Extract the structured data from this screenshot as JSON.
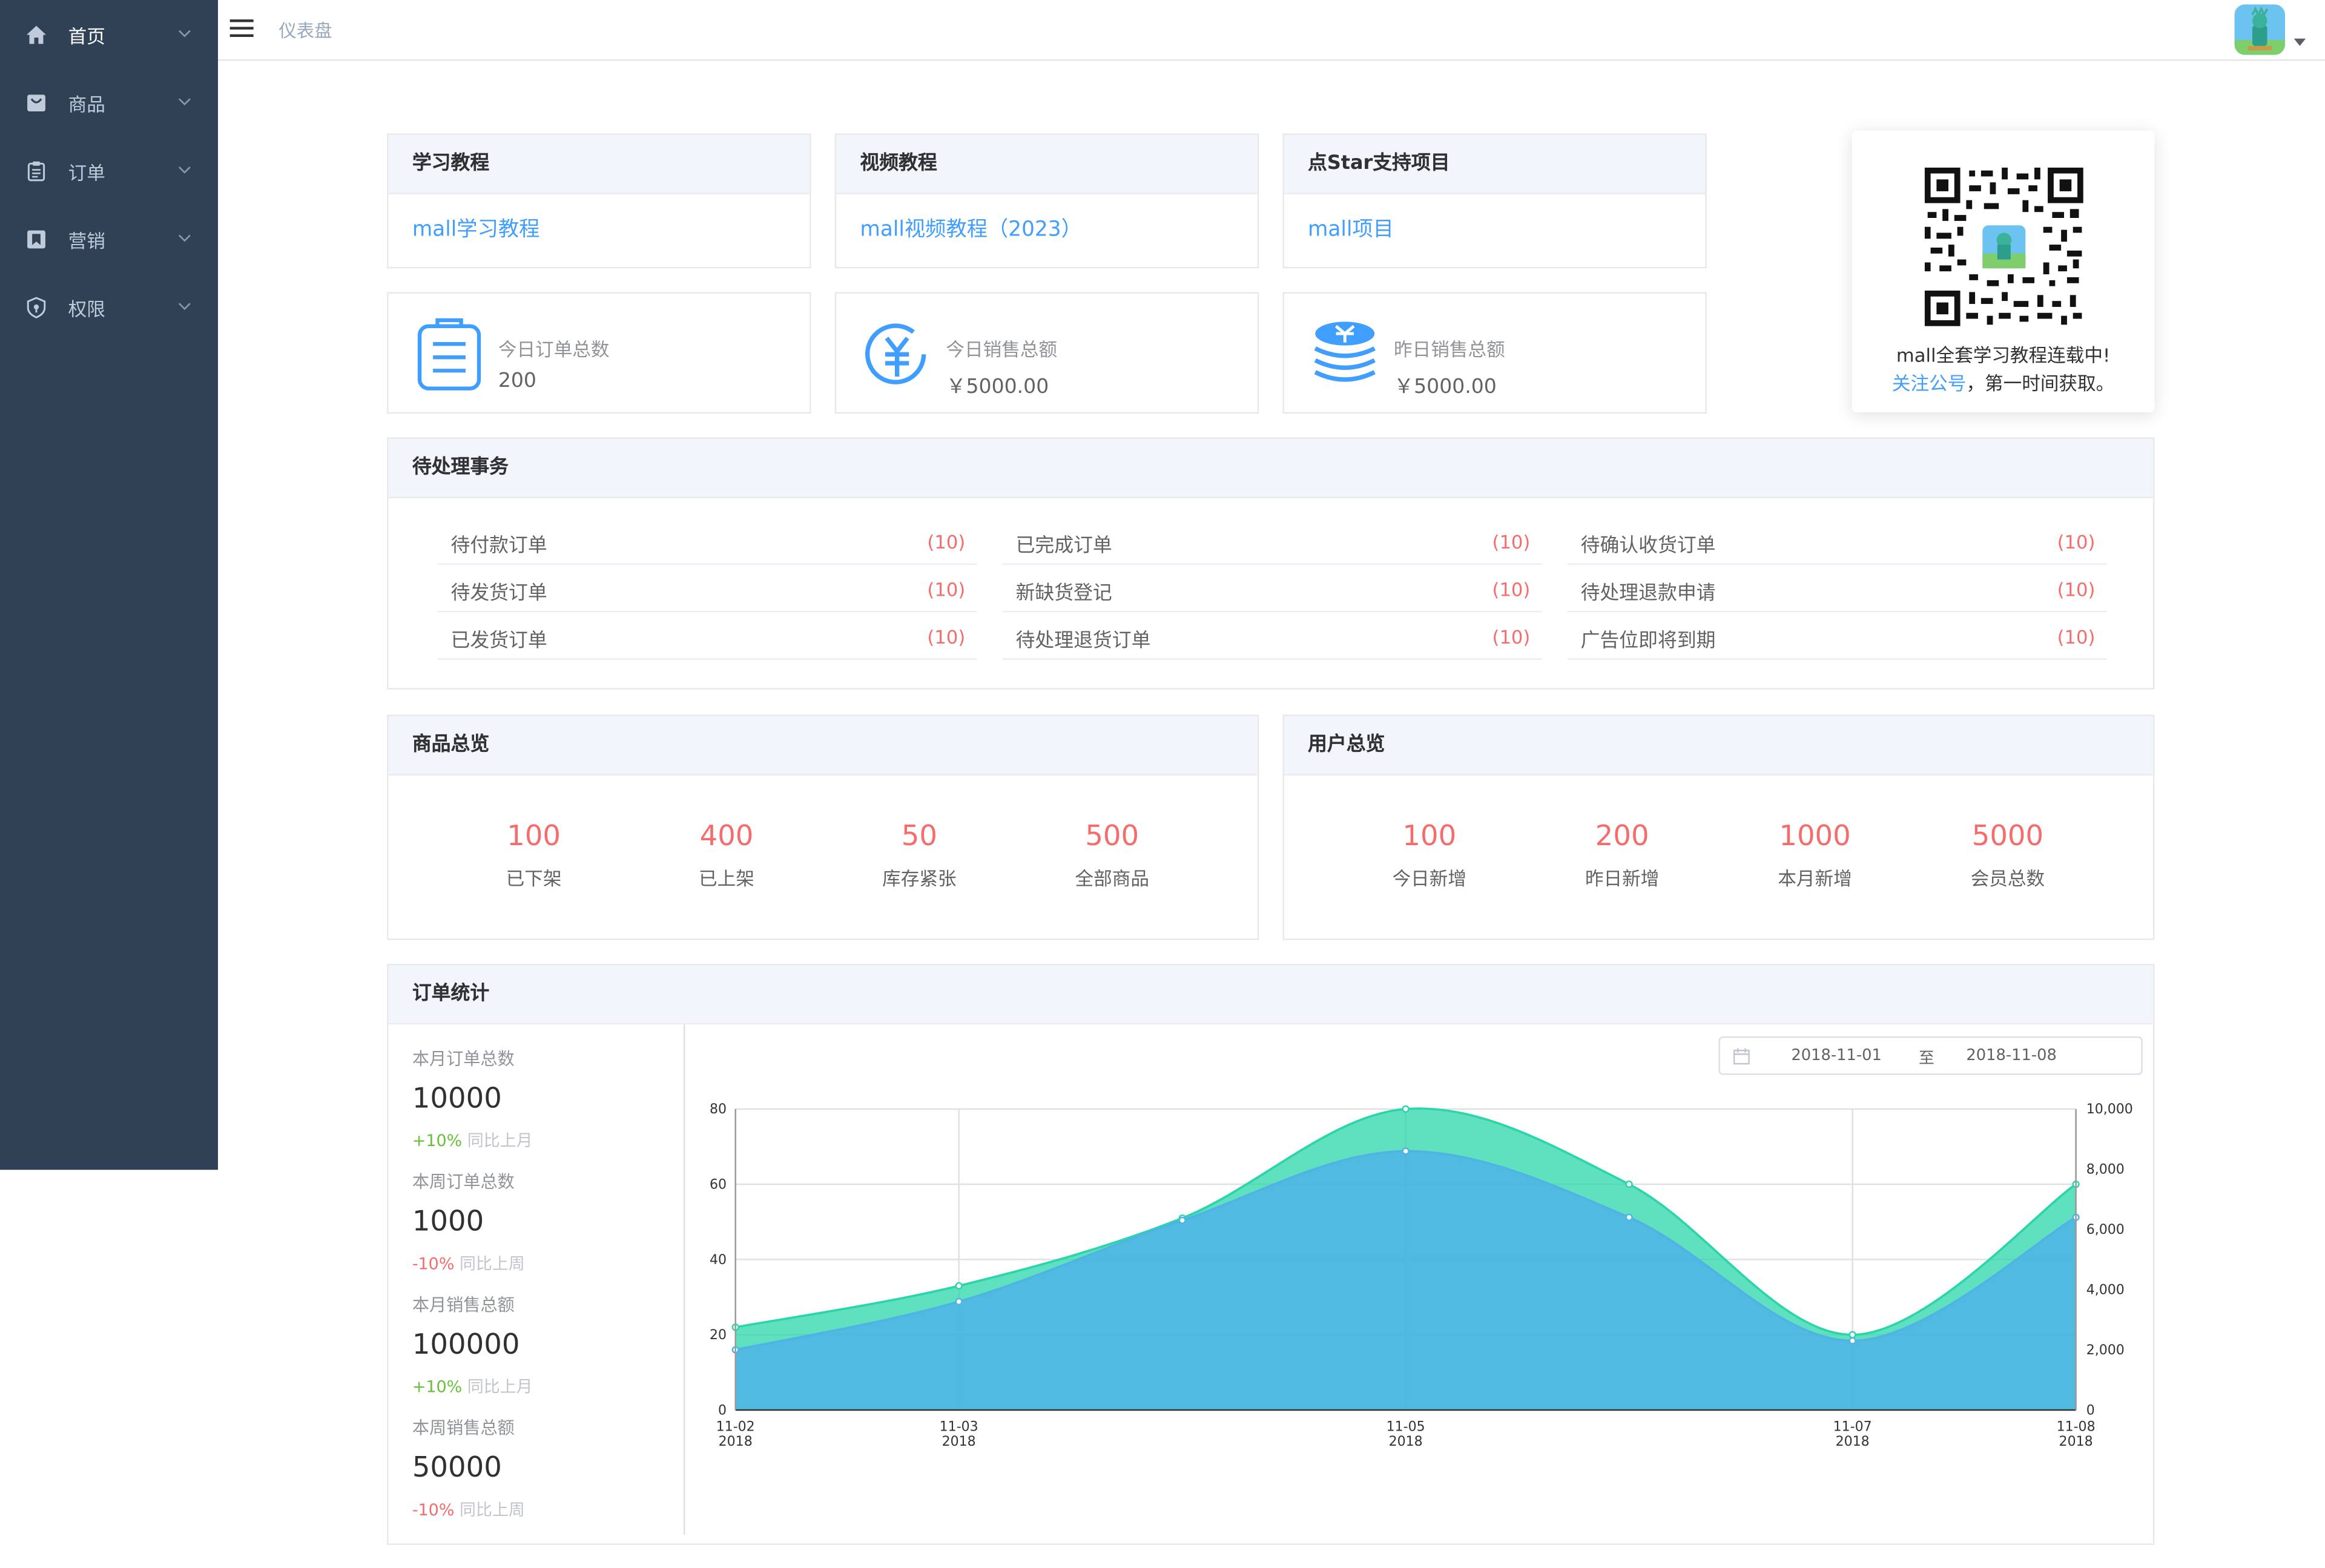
{
  "sidebar": {
    "items": [
      {
        "label": "首页",
        "icon": "home-icon"
      },
      {
        "label": "商品",
        "icon": "product-icon"
      },
      {
        "label": "订单",
        "icon": "order-icon"
      },
      {
        "label": "营销",
        "icon": "marketing-icon"
      },
      {
        "label": "权限",
        "icon": "permission-icon"
      }
    ]
  },
  "header": {
    "breadcrumb": "仪表盘",
    "menu_icon": "hamburger-icon",
    "avatar_icon": "avatar-icon"
  },
  "tutorials": [
    {
      "title": "学习教程",
      "link": "mall学习教程"
    },
    {
      "title": "视频教程",
      "link": "mall视频教程（2023）"
    },
    {
      "title": "点Star支持项目",
      "link": "mall项目"
    }
  ],
  "stats": [
    {
      "title": "今日订单总数",
      "value": "200",
      "icon": "clipboard-icon"
    },
    {
      "title": "今日销售总额",
      "value": "￥5000.00",
      "icon": "yuan-icon"
    },
    {
      "title": "昨日销售总额",
      "value": "￥5000.00",
      "icon": "coins-icon"
    }
  ],
  "qrcode": {
    "line1": "mall全套学习教程连载中!",
    "link": "关注公号",
    "line2_rest": "，第一时间获取。"
  },
  "todo": {
    "title": "待处理事务",
    "columns": [
      [
        {
          "label": "待付款订单",
          "count": "(10)"
        },
        {
          "label": "待发货订单",
          "count": "(10)"
        },
        {
          "label": "已发货订单",
          "count": "(10)"
        }
      ],
      [
        {
          "label": "已完成订单",
          "count": "(10)"
        },
        {
          "label": "新缺货登记",
          "count": "(10)"
        },
        {
          "label": "待处理退货订单",
          "count": "(10)"
        }
      ],
      [
        {
          "label": "待确认收货订单",
          "count": "(10)"
        },
        {
          "label": "待处理退款申请",
          "count": "(10)"
        },
        {
          "label": "广告位即将到期",
          "count": "(10)"
        }
      ]
    ]
  },
  "product_overview": {
    "title": "商品总览",
    "items": [
      {
        "value": "100",
        "label": "已下架"
      },
      {
        "value": "400",
        "label": "已上架"
      },
      {
        "value": "50",
        "label": "库存紧张"
      },
      {
        "value": "500",
        "label": "全部商品"
      }
    ]
  },
  "user_overview": {
    "title": "用户总览",
    "items": [
      {
        "value": "100",
        "label": "今日新增"
      },
      {
        "value": "200",
        "label": "昨日新增"
      },
      {
        "value": "1000",
        "label": "本月新增"
      },
      {
        "value": "5000",
        "label": "会员总数"
      }
    ]
  },
  "order_stats": {
    "title": "订单统计",
    "blocks": [
      {
        "title": "本月订单总数",
        "value": "10000",
        "change": "+10%",
        "compare": "同比上月",
        "trend": "up"
      },
      {
        "title": "本周订单总数",
        "value": "1000",
        "change": "-10%",
        "compare": "同比上周",
        "trend": "down"
      },
      {
        "title": "本月销售总额",
        "value": "100000",
        "change": "+10%",
        "compare": "同比上月",
        "trend": "up"
      },
      {
        "title": "本周销售总额",
        "value": "50000",
        "change": "-10%",
        "compare": "同比上周",
        "trend": "down"
      }
    ],
    "date_range": {
      "start": "2018-11-01",
      "separator": "至",
      "end": "2018-11-08",
      "icon": "calendar-icon"
    }
  },
  "colors": {
    "sidebar_bg": "#304156",
    "link": "#409eff",
    "danger": "#f56c6c",
    "success": "#67c23a",
    "series_orders": "#2ad6a9",
    "series_sales": "#4fb3e6"
  },
  "chart_data": {
    "type": "area",
    "x": [
      "2018-11-02",
      "2018-11-03",
      "2018-11-04",
      "2018-11-05",
      "2018-11-06",
      "2018-11-07",
      "2018-11-08"
    ],
    "x_tick_labels": [
      {
        "date": "11-02",
        "year": "2018"
      },
      {
        "date": "11-03",
        "year": "2018"
      },
      {
        "date": "11-05",
        "year": "2018"
      },
      {
        "date": "11-07",
        "year": "2018"
      },
      {
        "date": "11-08",
        "year": "2018"
      }
    ],
    "series": [
      {
        "axis": "left",
        "color": "#2ad6a9",
        "values": [
          22,
          33,
          51,
          80,
          60,
          20,
          60
        ]
      },
      {
        "axis": "right",
        "color": "#4fb3e6",
        "values": [
          2000,
          3600,
          6300,
          8600,
          6400,
          2300,
          6400
        ]
      }
    ],
    "y_left": {
      "min": 0,
      "max": 80,
      "ticks": [
        "0",
        "20",
        "40",
        "60",
        "80"
      ]
    },
    "y_right": {
      "min": 0,
      "max": 10000,
      "ticks": [
        "0",
        "2,000",
        "4,000",
        "6,000",
        "8,000",
        "10,000"
      ]
    },
    "grid": true
  }
}
